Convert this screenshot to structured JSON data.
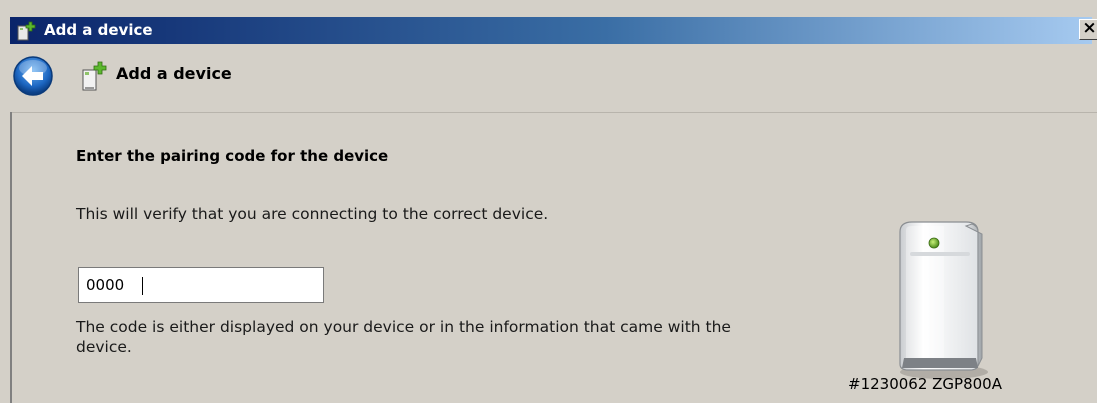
{
  "window": {
    "title": "Add a device",
    "close_label": "×"
  },
  "header": {
    "title": "Add a device",
    "back_icon": "back-arrow-icon",
    "wizard_icon": "add-device-icon"
  },
  "content": {
    "heading": "Enter the pairing code for the device",
    "description": "This will verify that you are connecting to the correct device.",
    "code_input": {
      "value": "0000"
    },
    "hint": "The code is either displayed on your device or in the information that came with the device.",
    "device": {
      "icon": "device-tower-icon",
      "name": "#1230062 ZGP800A"
    }
  }
}
